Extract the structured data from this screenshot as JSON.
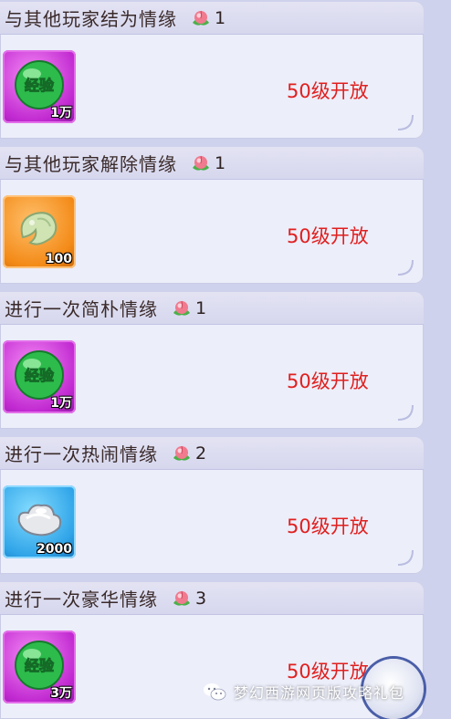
{
  "tasks": [
    {
      "title": "与其他玩家结为情缘",
      "reward_icon": "peach-icon",
      "reward_count": "1",
      "item_icon": "exp-orb-icon",
      "item_label": "经验",
      "item_qty": "1万",
      "slot_color": "magenta",
      "status": "50级开放"
    },
    {
      "title": "与其他玩家解除情缘",
      "reward_icon": "peach-icon",
      "reward_count": "1",
      "item_icon": "jade-pendant-icon",
      "item_label": "",
      "item_qty": "100",
      "slot_color": "orange",
      "status": "50级开放"
    },
    {
      "title": "进行一次简朴情缘",
      "reward_icon": "peach-icon",
      "reward_count": "1",
      "item_icon": "exp-orb-icon",
      "item_label": "经验",
      "item_qty": "1万",
      "slot_color": "magenta",
      "status": "50级开放"
    },
    {
      "title": "进行一次热闹情缘",
      "reward_icon": "peach-icon",
      "reward_count": "2",
      "item_icon": "silver-ingot-icon",
      "item_label": "",
      "item_qty": "2000",
      "slot_color": "blue",
      "status": "50级开放"
    },
    {
      "title": "进行一次豪华情缘",
      "reward_icon": "peach-icon",
      "reward_count": "3",
      "item_icon": "exp-orb-icon",
      "item_label": "经验",
      "item_qty": "3万",
      "slot_color": "magenta",
      "status": "50级开放"
    }
  ],
  "watermark": {
    "text": "梦幻西游网页版攻略礼包",
    "icon": "wechat-icon"
  },
  "colors": {
    "status": "#e0201f",
    "panel": "#eceefa",
    "header": "#d6d7ee",
    "background": "#cfd2ec"
  }
}
